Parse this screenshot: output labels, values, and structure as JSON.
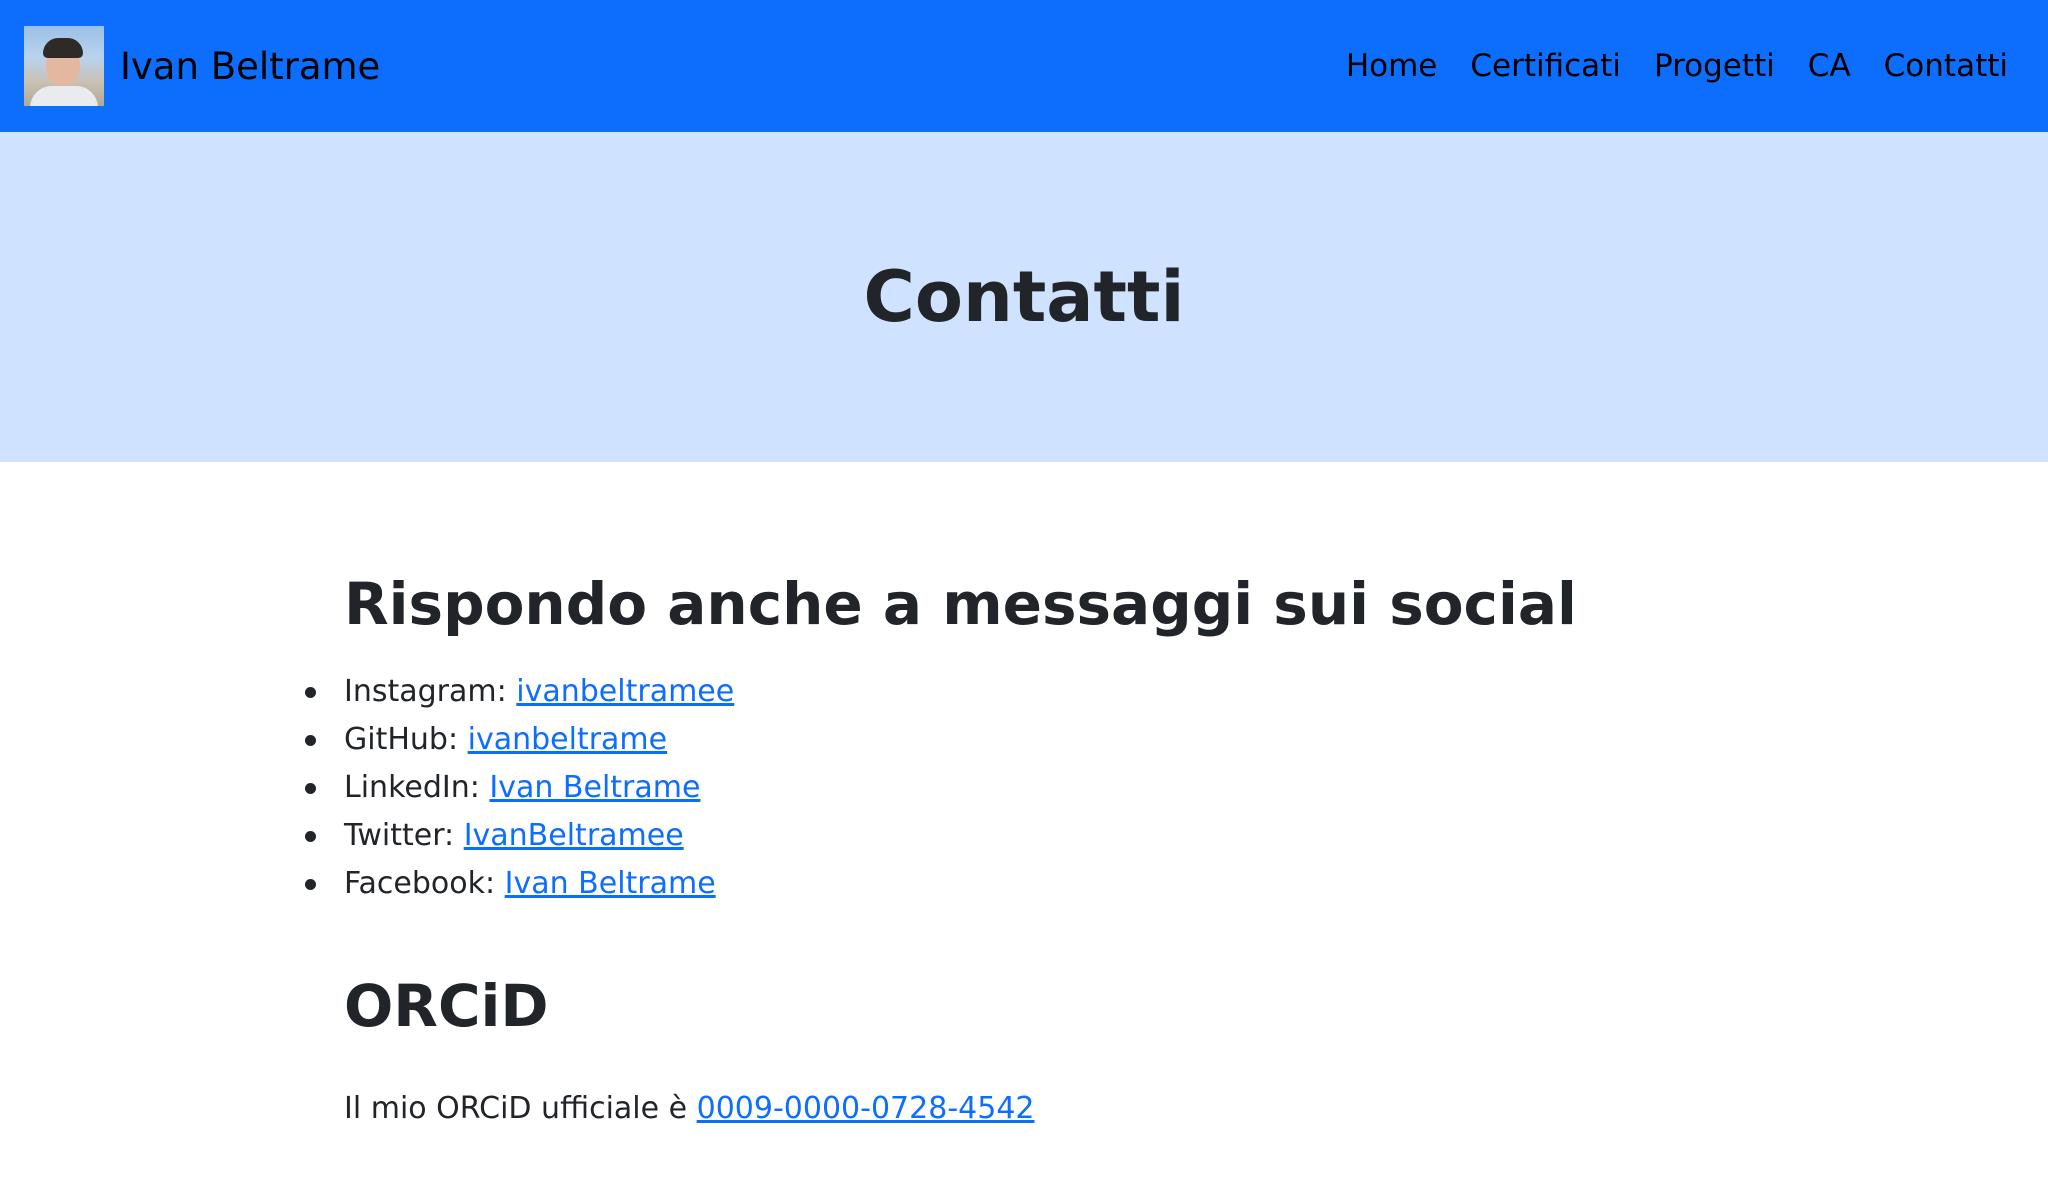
{
  "navbar": {
    "brand_name": "Ivan Beltrame",
    "items": [
      {
        "label": "Home"
      },
      {
        "label": "Certificati"
      },
      {
        "label": "Progetti"
      },
      {
        "label": "CA"
      },
      {
        "label": "Contatti"
      }
    ],
    "colors": {
      "background": "#0d6efd",
      "text": "#000000"
    }
  },
  "hero": {
    "title": "Contatti",
    "background": "#cfe2ff"
  },
  "social": {
    "heading": "Rispondo anche a messaggi sui social",
    "items": [
      {
        "platform": "Instagram:",
        "handle": "ivanbeltramee"
      },
      {
        "platform": "GitHub:",
        "handle": "ivanbeltrame"
      },
      {
        "platform": "LinkedIn:",
        "handle": "Ivan Beltrame"
      },
      {
        "platform": "Twitter:",
        "handle": "IvanBeltramee"
      },
      {
        "platform": "Facebook:",
        "handle": "Ivan Beltrame"
      }
    ]
  },
  "orcid": {
    "heading": "ORCiD",
    "text": "Il mio ORCiD ufficiale è",
    "id": "0009-0000-0728-4542"
  },
  "colors": {
    "link": "#0d6efd",
    "body_text": "#212529"
  }
}
